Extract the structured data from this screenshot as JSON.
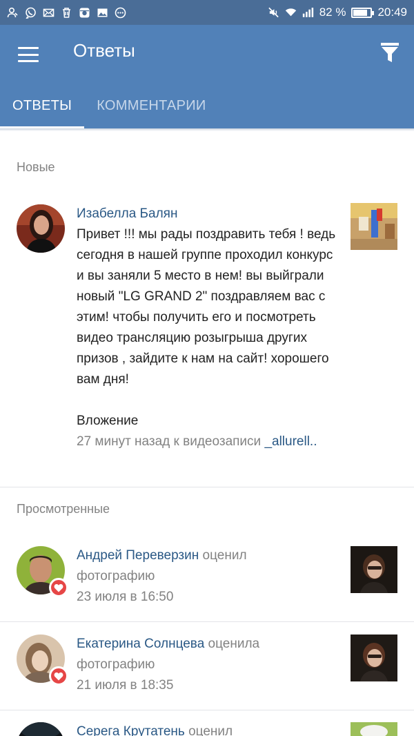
{
  "status_bar": {
    "battery_percent": "82 %",
    "battery_level": 0.82,
    "time": "20:49",
    "left_icons": [
      "person-icon",
      "viber-icon",
      "mail-icon",
      "trash-icon",
      "instagram-icon",
      "image-icon",
      "more-icon"
    ],
    "right_icons": [
      "mute-icon",
      "wifi-icon",
      "signal-icon",
      "battery-icon"
    ]
  },
  "appbar": {
    "title": "Ответы",
    "tabs": [
      {
        "label": "ОТВЕТЫ",
        "active": true
      },
      {
        "label": "КОММЕНТАРИИ",
        "active": false
      }
    ]
  },
  "sections": {
    "new_title": "Новые",
    "viewed_title": "Просмотренные"
  },
  "new_item": {
    "name": "Изабелла Балян",
    "text": "Привет !!! мы рады поздравить тебя ! ведь сегодня в нашей группе проходил конкурс и вы заняли 5 место в нем! вы выйграли новый \"LG GRAND 2\" поздравляем вас с этим! чтобы получить его и посмотреть видео трансляцию розыгрыша других призов , зайдите к нам на сайт! хорошего вам дня!",
    "attachment": "Вложение",
    "meta_prefix": "27 минут назад к видеозаписи",
    "meta_link": "_allurell.."
  },
  "viewed_items": [
    {
      "name": "Андрей Переверзин",
      "action": "оценил",
      "object": "фотографию",
      "time": "23 июля в 16:50"
    },
    {
      "name": "Екатерина Солнцева",
      "action": "оценила",
      "object": "фотографию",
      "time": "21 июля в 18:35"
    },
    {
      "name": "Серега Крутатень",
      "action": "оценил",
      "object": "",
      "time": ""
    }
  ],
  "colors": {
    "status_bar": "#4a6d97",
    "app_bar": "#5181b8",
    "link": "#2a5885",
    "like_badge": "#e64646"
  }
}
